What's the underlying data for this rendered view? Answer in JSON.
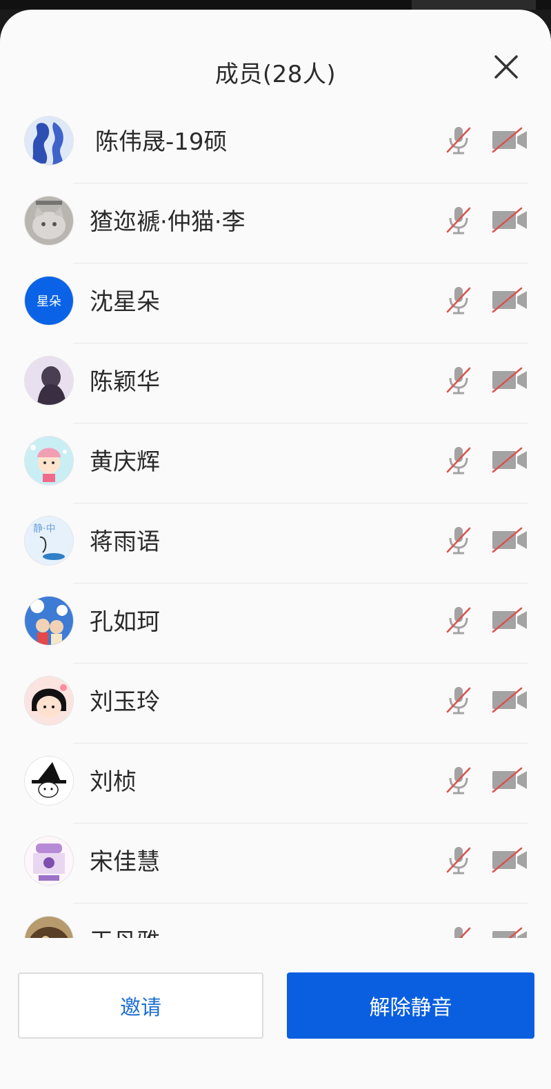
{
  "header": {
    "title": "成员(28人)"
  },
  "members": [
    {
      "name": "陈伟晟-19硕",
      "avatar": "blue-ink-portrait"
    },
    {
      "name": "猹迩褫·仲猫·李",
      "avatar": "cat-photo"
    },
    {
      "name": "沈星朵",
      "avatar_text": "星朵"
    },
    {
      "name": "陈颖华",
      "avatar": "girl-silhouette"
    },
    {
      "name": "黄庆辉",
      "avatar": "cartoon-girl-pig-hat"
    },
    {
      "name": "蒋雨语",
      "avatar": "sketch-whale"
    },
    {
      "name": "孔如珂",
      "avatar": "anime-couple"
    },
    {
      "name": "刘玉玲",
      "avatar": "maruko"
    },
    {
      "name": "刘桢",
      "avatar": "witch-sketch"
    },
    {
      "name": "宋佳慧",
      "avatar": "purple-illustration"
    },
    {
      "name": "王丹雅",
      "avatar": "brown-illustration"
    }
  ],
  "footer": {
    "invite_label": "邀请",
    "unmute_label": "解除静音"
  },
  "colors": {
    "accent": "#0a5fe0",
    "muted_slash": "#d9534f",
    "icon_gray": "#9a9a9a"
  }
}
